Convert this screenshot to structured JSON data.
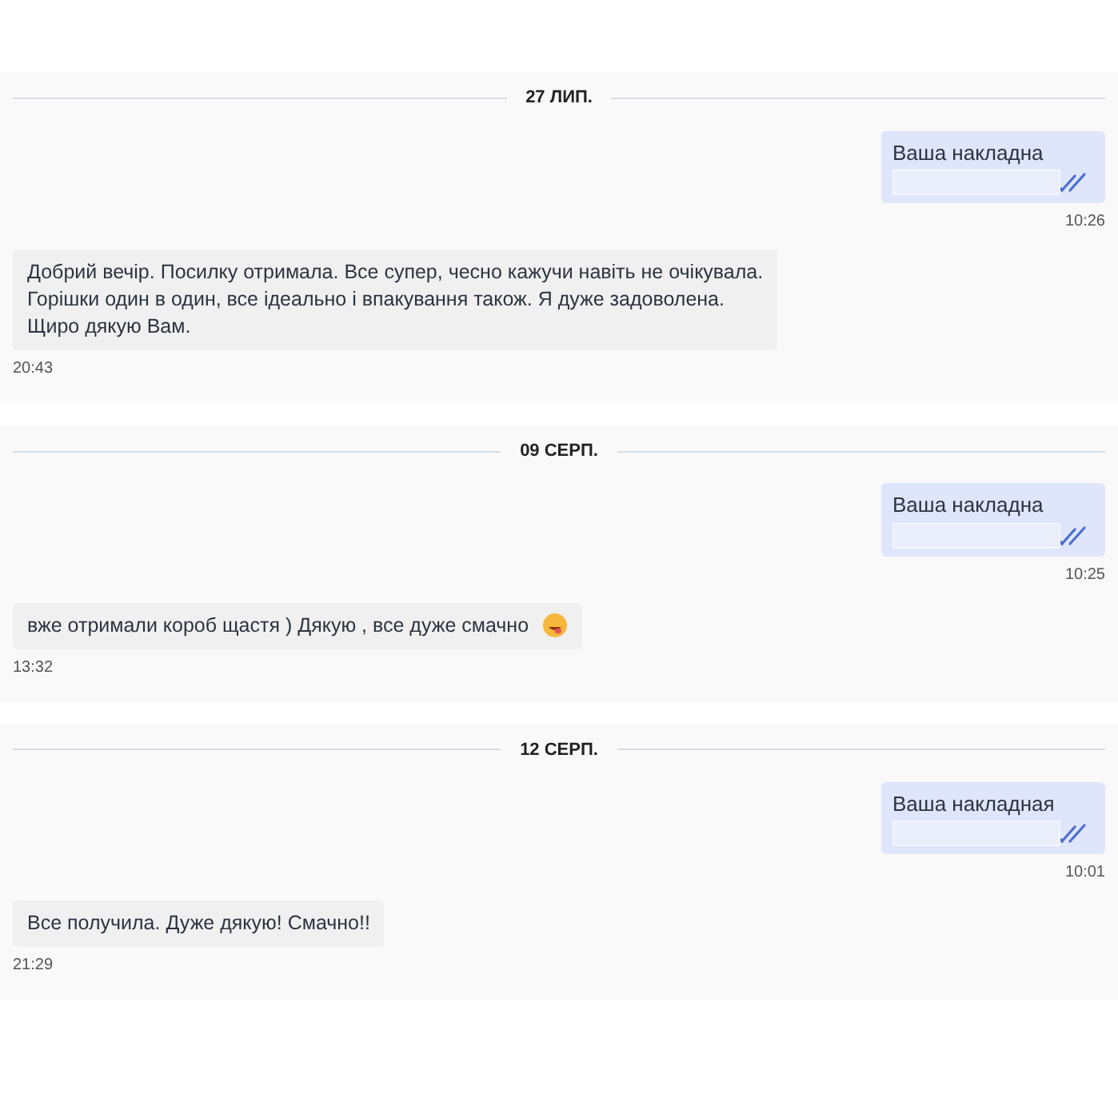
{
  "panels": [
    {
      "date": "27 ЛИП.",
      "messages": [
        {
          "kind": "outgoing",
          "text": "Ваша накладна",
          "time": "10:26",
          "read": true
        },
        {
          "kind": "incoming",
          "text": "Добрий вечір. Посилку отримала. Все супер, чесно кажучи навіть не очікувала.\nГорішки один в один, все ідеально і впакування також. Я дуже задоволена.\nЩиро дякую Вам.",
          "time": "20:43",
          "emoji": false
        }
      ]
    },
    {
      "date": "09 СЕРП.",
      "messages": [
        {
          "kind": "outgoing",
          "text": "Ваша накладна",
          "time": "10:25",
          "read": true
        },
        {
          "kind": "incoming",
          "text": "вже отримали короб щастя ) Дякую , все дуже смачно",
          "time": "13:32",
          "emoji": true
        }
      ]
    },
    {
      "date": "12 СЕРП.",
      "messages": [
        {
          "kind": "outgoing",
          "text": "Ваша накладная",
          "time": "10:01",
          "read": true
        },
        {
          "kind": "incoming",
          "text": "Все получила. Дуже дякую!  Смачно!!",
          "time": "21:29",
          "emoji": false
        }
      ]
    }
  ]
}
